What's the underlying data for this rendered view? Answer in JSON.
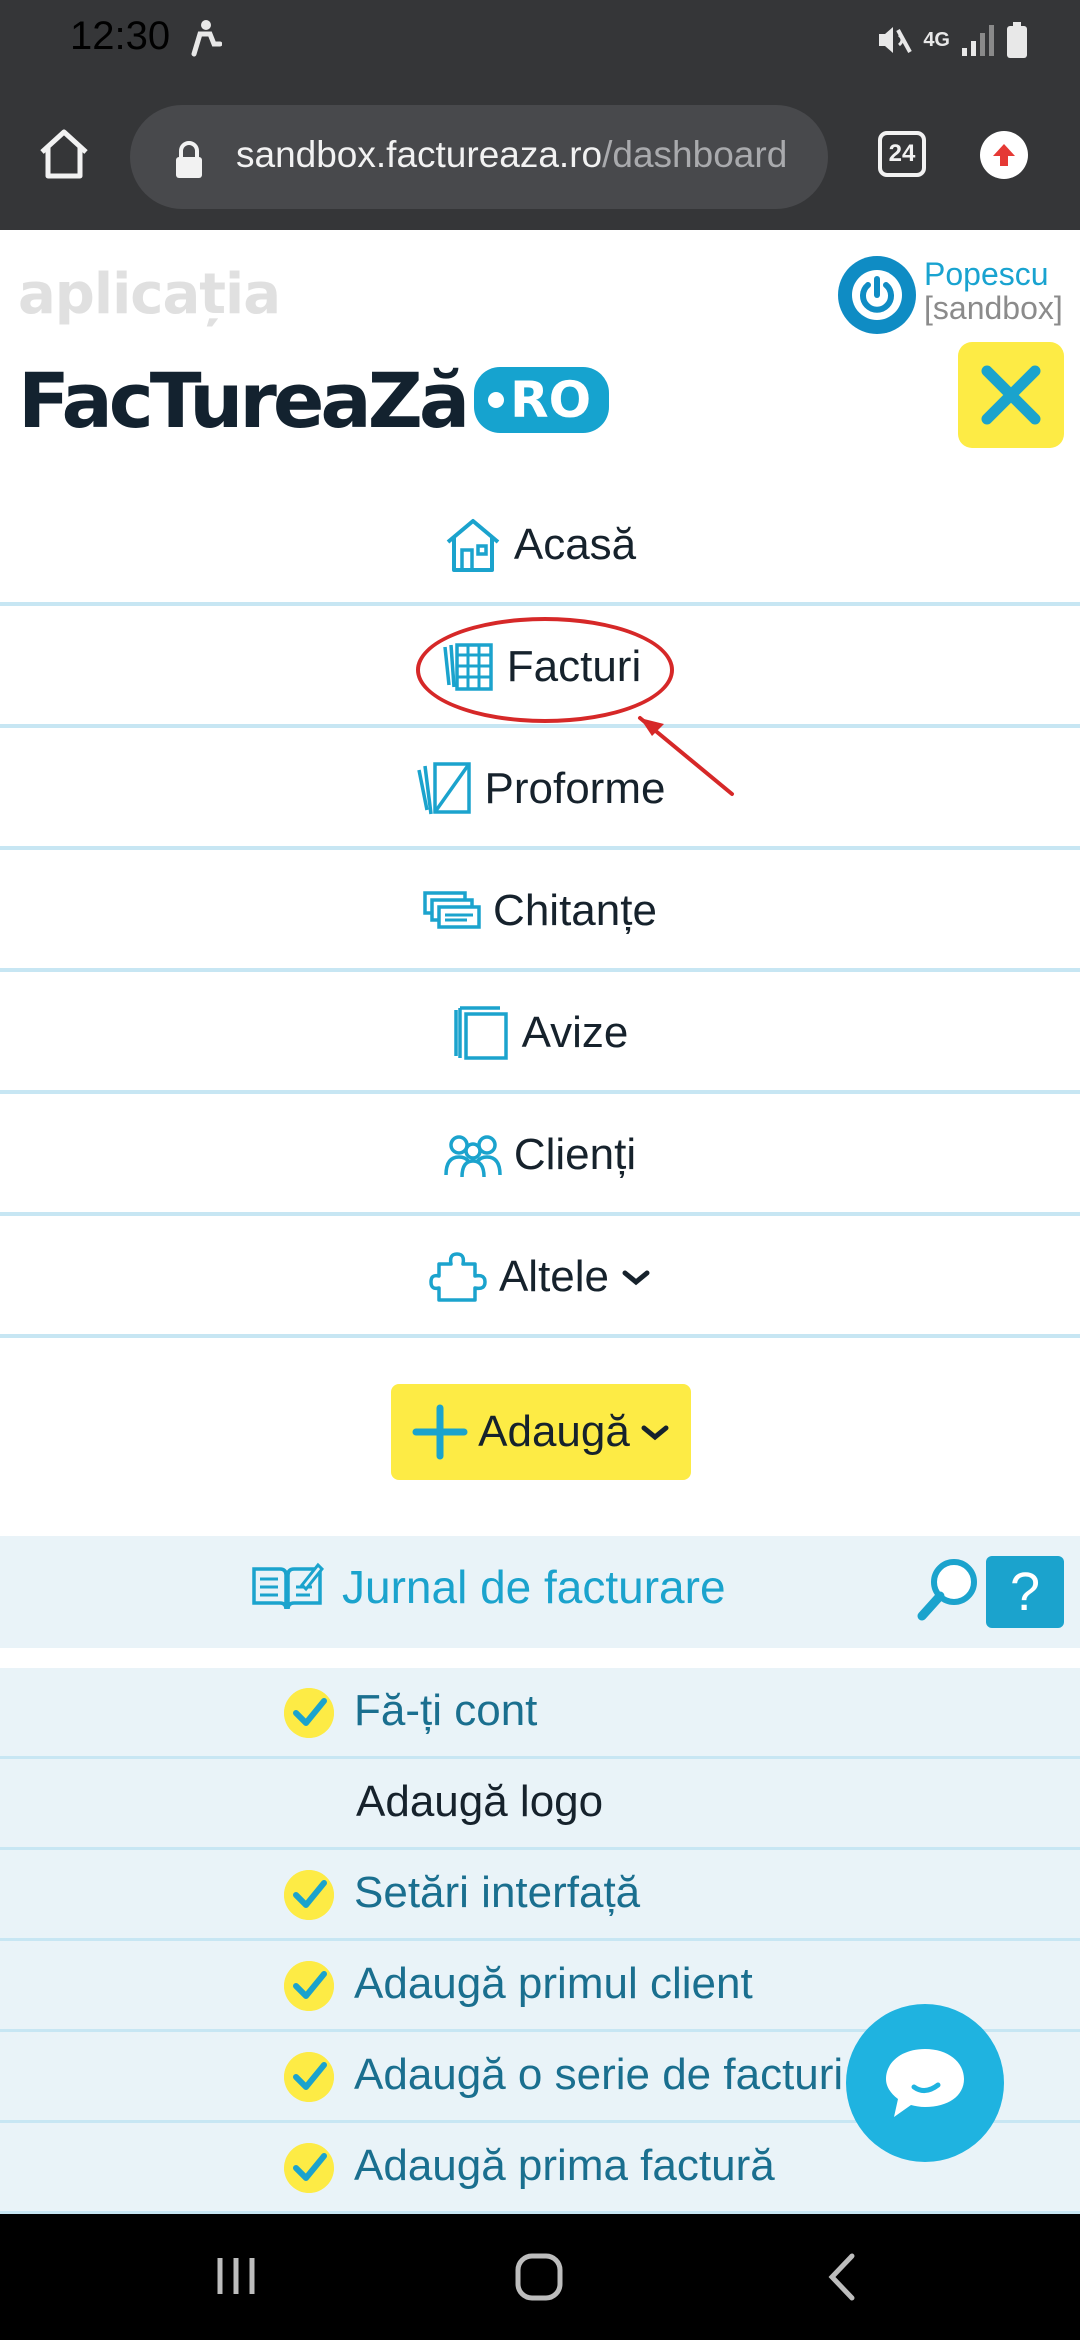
{
  "status": {
    "time": "12:30",
    "network": "4G"
  },
  "browser": {
    "url_host": "sandbox.factureaza.ro",
    "url_path": "/dashboard",
    "tab_count": "24"
  },
  "header": {
    "subtitle": "aplicația",
    "logo_text": "FacTureaZă",
    "logo_badge": "RO",
    "user_name": "Popescu",
    "user_env": "[sandbox]"
  },
  "menu": {
    "items": [
      {
        "label": "Acasă",
        "icon": "house-icon"
      },
      {
        "label": "Facturi",
        "icon": "invoices-icon"
      },
      {
        "label": "Proforme",
        "icon": "proforma-icon"
      },
      {
        "label": "Chitanțe",
        "icon": "receipts-icon"
      },
      {
        "label": "Avize",
        "icon": "delivery-notes-icon"
      },
      {
        "label": "Clienți",
        "icon": "clients-icon"
      },
      {
        "label": "Altele",
        "icon": "puzzle-icon"
      }
    ],
    "add_label": "Adaugă"
  },
  "journal": {
    "title": "Jurnal de facturare",
    "help_label": "?",
    "todos": [
      {
        "label": "Fă-ți cont",
        "done": true
      },
      {
        "label": "Adaugă logo",
        "done": false
      },
      {
        "label": "Setări interfață",
        "done": true
      },
      {
        "label": "Adaugă primul client",
        "done": true
      },
      {
        "label": "Adaugă o serie de facturi",
        "done": true
      },
      {
        "label": "Adaugă prima factură",
        "done": true
      }
    ]
  },
  "colors": {
    "accent": "#1ba3cd",
    "highlight": "#fdeb45",
    "annotation": "#d62828",
    "dark": "#353638"
  }
}
